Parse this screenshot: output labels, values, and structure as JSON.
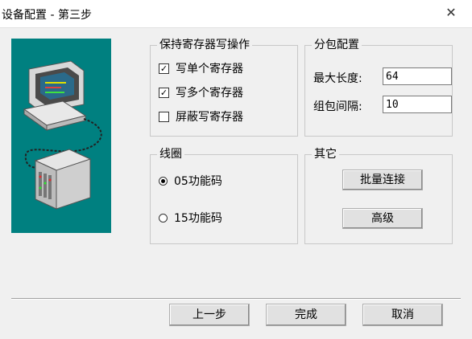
{
  "window": {
    "title": "设备配置 - 第三步",
    "close_glyph": "✕"
  },
  "illustration": {
    "name": "network-computer-illustration",
    "background": "#008080"
  },
  "holding": {
    "label": "保持寄存器写操作",
    "items": [
      {
        "label": "写单个寄存器",
        "checked": true,
        "mark": "✓"
      },
      {
        "label": "写多个寄存器",
        "checked": true,
        "mark": "✓"
      },
      {
        "label": "屏蔽写寄存器",
        "checked": false,
        "mark": ""
      }
    ]
  },
  "packet": {
    "label": "分包配置",
    "max_length_label": "最大长度:",
    "max_length_value": "64",
    "interval_label": "组包间隔:",
    "interval_value": "10"
  },
  "coil": {
    "label": "线圈",
    "options": [
      {
        "label": "05功能码",
        "selected": true
      },
      {
        "label": "15功能码",
        "selected": false
      }
    ]
  },
  "other": {
    "label": "其它",
    "batch_connect": "批量连接",
    "advanced": "高级"
  },
  "footer": {
    "prev": "上一步",
    "finish": "完成",
    "cancel": "取消"
  }
}
